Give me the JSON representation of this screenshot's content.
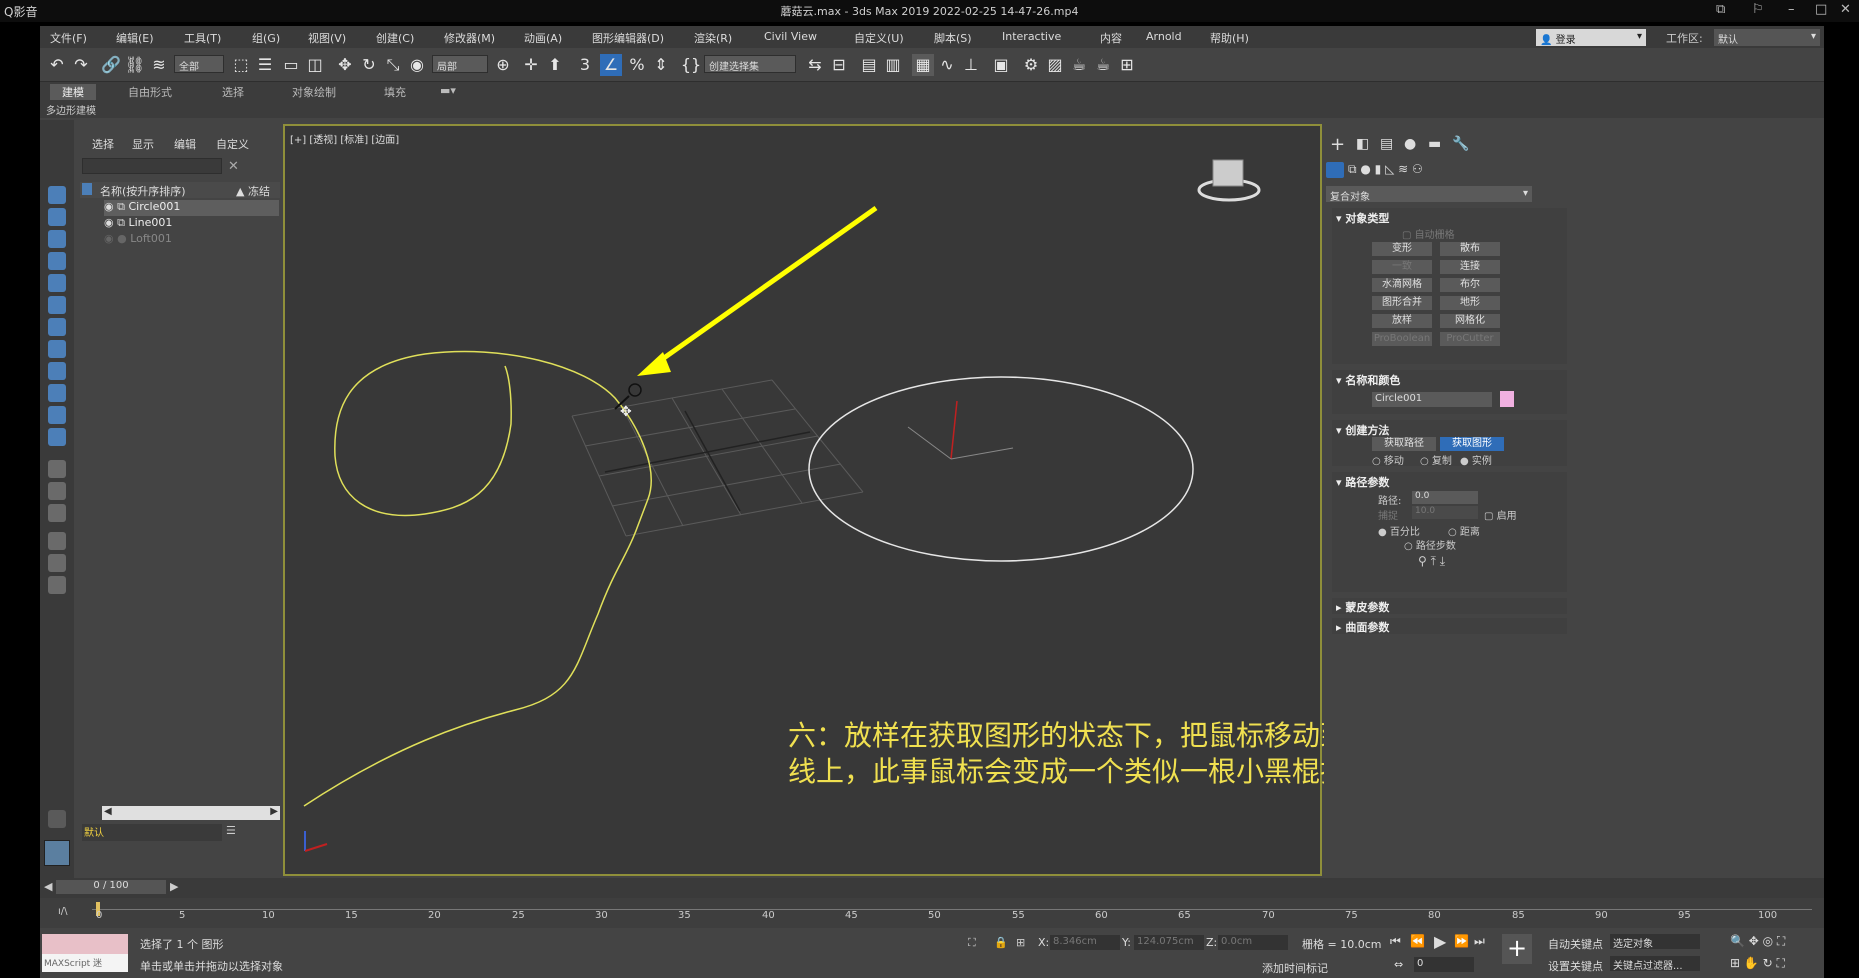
{
  "player": {
    "app_name": "Q影音",
    "title": "蘑菇云.max - 3ds Max 2019  2022-02-25 14-47-26.mp4"
  },
  "menu": [
    "文件(F)",
    "编辑(E)",
    "工具(T)",
    "组(G)",
    "视图(V)",
    "创建(C)",
    "修改器(M)",
    "动画(A)",
    "图形编辑器(D)",
    "渲染(R)",
    "Civil View",
    "自定义(U)",
    "脚本(S)",
    "Interactive",
    "内容",
    "Arnold",
    "帮助(H)"
  ],
  "account": {
    "login": "登录",
    "workspace_label": "工作区:",
    "workspace_value": "默认"
  },
  "toolbar": {
    "filter": "全部",
    "coord": "局部",
    "selection_set": "创建选择集"
  },
  "ribbon": {
    "tabs": [
      "建模",
      "自由形式",
      "选择",
      "对象绘制",
      "填充"
    ],
    "active": "建模",
    "sub": "多边形建模"
  },
  "explorer": {
    "tabs": [
      "选择",
      "显示",
      "编辑",
      "自定义"
    ],
    "column_name": "名称(按升序排序)",
    "column_freeze": "▲ 冻结",
    "rows": [
      {
        "name": "Circle001",
        "selected": true
      },
      {
        "name": "Line001",
        "selected": false
      },
      {
        "name": "Loft001",
        "selected": false,
        "dim": true
      }
    ],
    "layer": "默认"
  },
  "viewport": {
    "label": "[+] [透视] [标准] [边面]"
  },
  "subtitle": "六：放样在获取图形的状态下，把鼠标移动到我们创建的竖直方向的类似胚胎的样条线上，此事鼠标会变成一个类似一根小黑棍插在一个小圈里面的图形，然后点击鼠标",
  "command_panel": {
    "category": "复合对象",
    "object_type": {
      "title": "对象类型",
      "autogrid": "自动栅格",
      "buttons": [
        [
          "变形",
          "散布"
        ],
        [
          "一致",
          "连接"
        ],
        [
          "水滴网格",
          "布尔"
        ],
        [
          "图形合并",
          "地形"
        ],
        [
          "放样",
          "网格化"
        ],
        [
          "ProBoolean",
          "ProCutter"
        ]
      ]
    },
    "name_color": {
      "title": "名称和颜色",
      "name": "Circle001",
      "swatch": "#f0b0e0"
    },
    "creation": {
      "title": "创建方法",
      "get_path": "获取路径",
      "get_shape": "获取图形",
      "options": [
        "移动",
        "复制",
        "实例"
      ]
    },
    "path_params": {
      "title": "路径参数",
      "path_label": "路径:",
      "path_value": "0.0",
      "snap_label": "捕捉",
      "snap_value": "10.0",
      "enable": "启用",
      "percent": "百分比",
      "distance": "距离",
      "steps": "路径步数"
    },
    "skin_params": "蒙皮参数",
    "surface_params": "曲面参数"
  },
  "timeline": {
    "frame": "0 / 100",
    "ticks": [
      "0",
      "5",
      "10",
      "15",
      "20",
      "25",
      "30",
      "35",
      "40",
      "45",
      "50",
      "55",
      "60",
      "65",
      "70",
      "75",
      "80",
      "85",
      "90",
      "95",
      "100"
    ]
  },
  "status": {
    "script": "MAXScript 迷",
    "selected": "选择了 1 个 图形",
    "hint": "单击或单击并拖动以选择对象",
    "x_label": "X:",
    "x_value": "8.346cm",
    "y_label": "Y:",
    "y_value": "124.075cm",
    "z_label": "Z:",
    "z_value": "0.0cm",
    "grid": "栅格 = 10.0cm",
    "add_time_tag": "添加时间标记",
    "auto_key": "自动关键点",
    "set_key": "设置关键点",
    "selected_obj": "选定对象",
    "key_filter": "关键点过滤器...",
    "frame_field": "0"
  }
}
